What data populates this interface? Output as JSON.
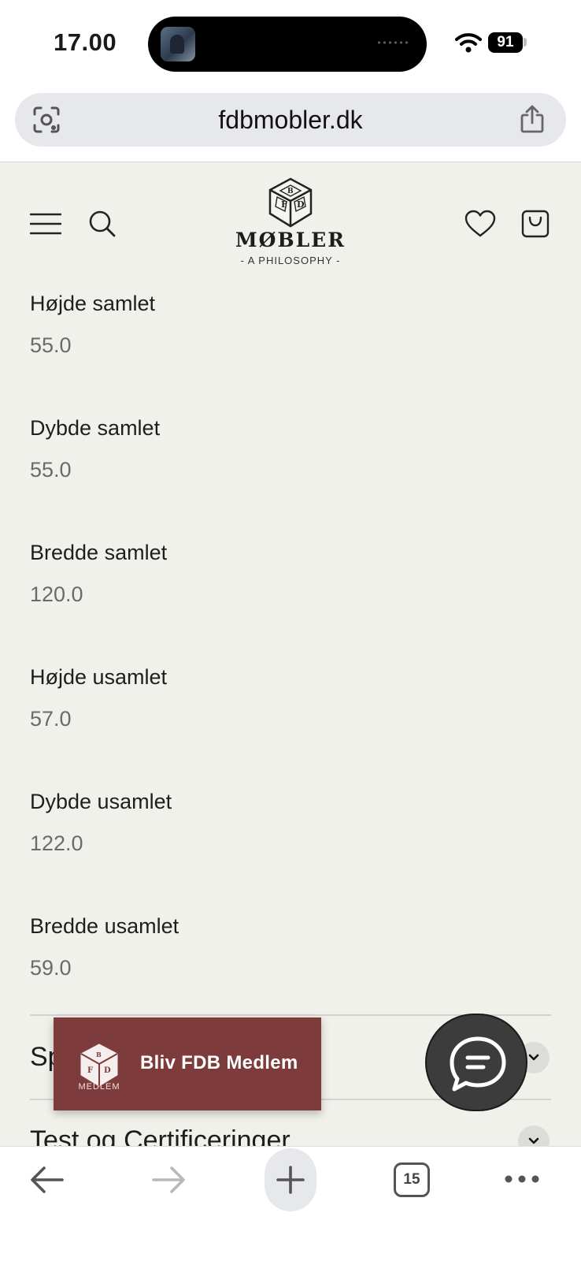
{
  "status_bar": {
    "time": "17.00",
    "battery": "91"
  },
  "browser": {
    "url": "fdbmobler.dk",
    "tab_count": "15"
  },
  "site": {
    "logo": {
      "wordmark": "MØBLER",
      "tagline": "- A PHILOSOPHY -",
      "monogram": "FDB"
    },
    "specs": [
      {
        "label": "Højde samlet",
        "value": "55.0"
      },
      {
        "label": "Dybde samlet",
        "value": "55.0"
      },
      {
        "label": "Bredde samlet",
        "value": "120.0"
      },
      {
        "label": "Højde usamlet",
        "value": "57.0"
      },
      {
        "label": "Dybde usamlet",
        "value": "122.0"
      },
      {
        "label": "Bredde usamlet",
        "value": "59.0"
      }
    ],
    "accordions": [
      {
        "label": "Sp"
      },
      {
        "label": "Test og Certificeringer"
      }
    ],
    "member_banner": {
      "text": "Bliv FDB Medlem",
      "sub": "MEDLEM"
    }
  },
  "colors": {
    "page_bg": "#f1f1ec",
    "banner": "#7d3b3b",
    "chat": "#3c3c3c",
    "url_bar": "#e6e8eb"
  },
  "icons": [
    "camera-lens-icon",
    "share-icon",
    "hamburger-menu-icon",
    "search-icon",
    "heart-icon",
    "shopping-bag-icon",
    "chevron-down-icon",
    "chat-icon",
    "back-arrow-icon",
    "forward-arrow-icon",
    "plus-icon",
    "more-icon"
  ]
}
